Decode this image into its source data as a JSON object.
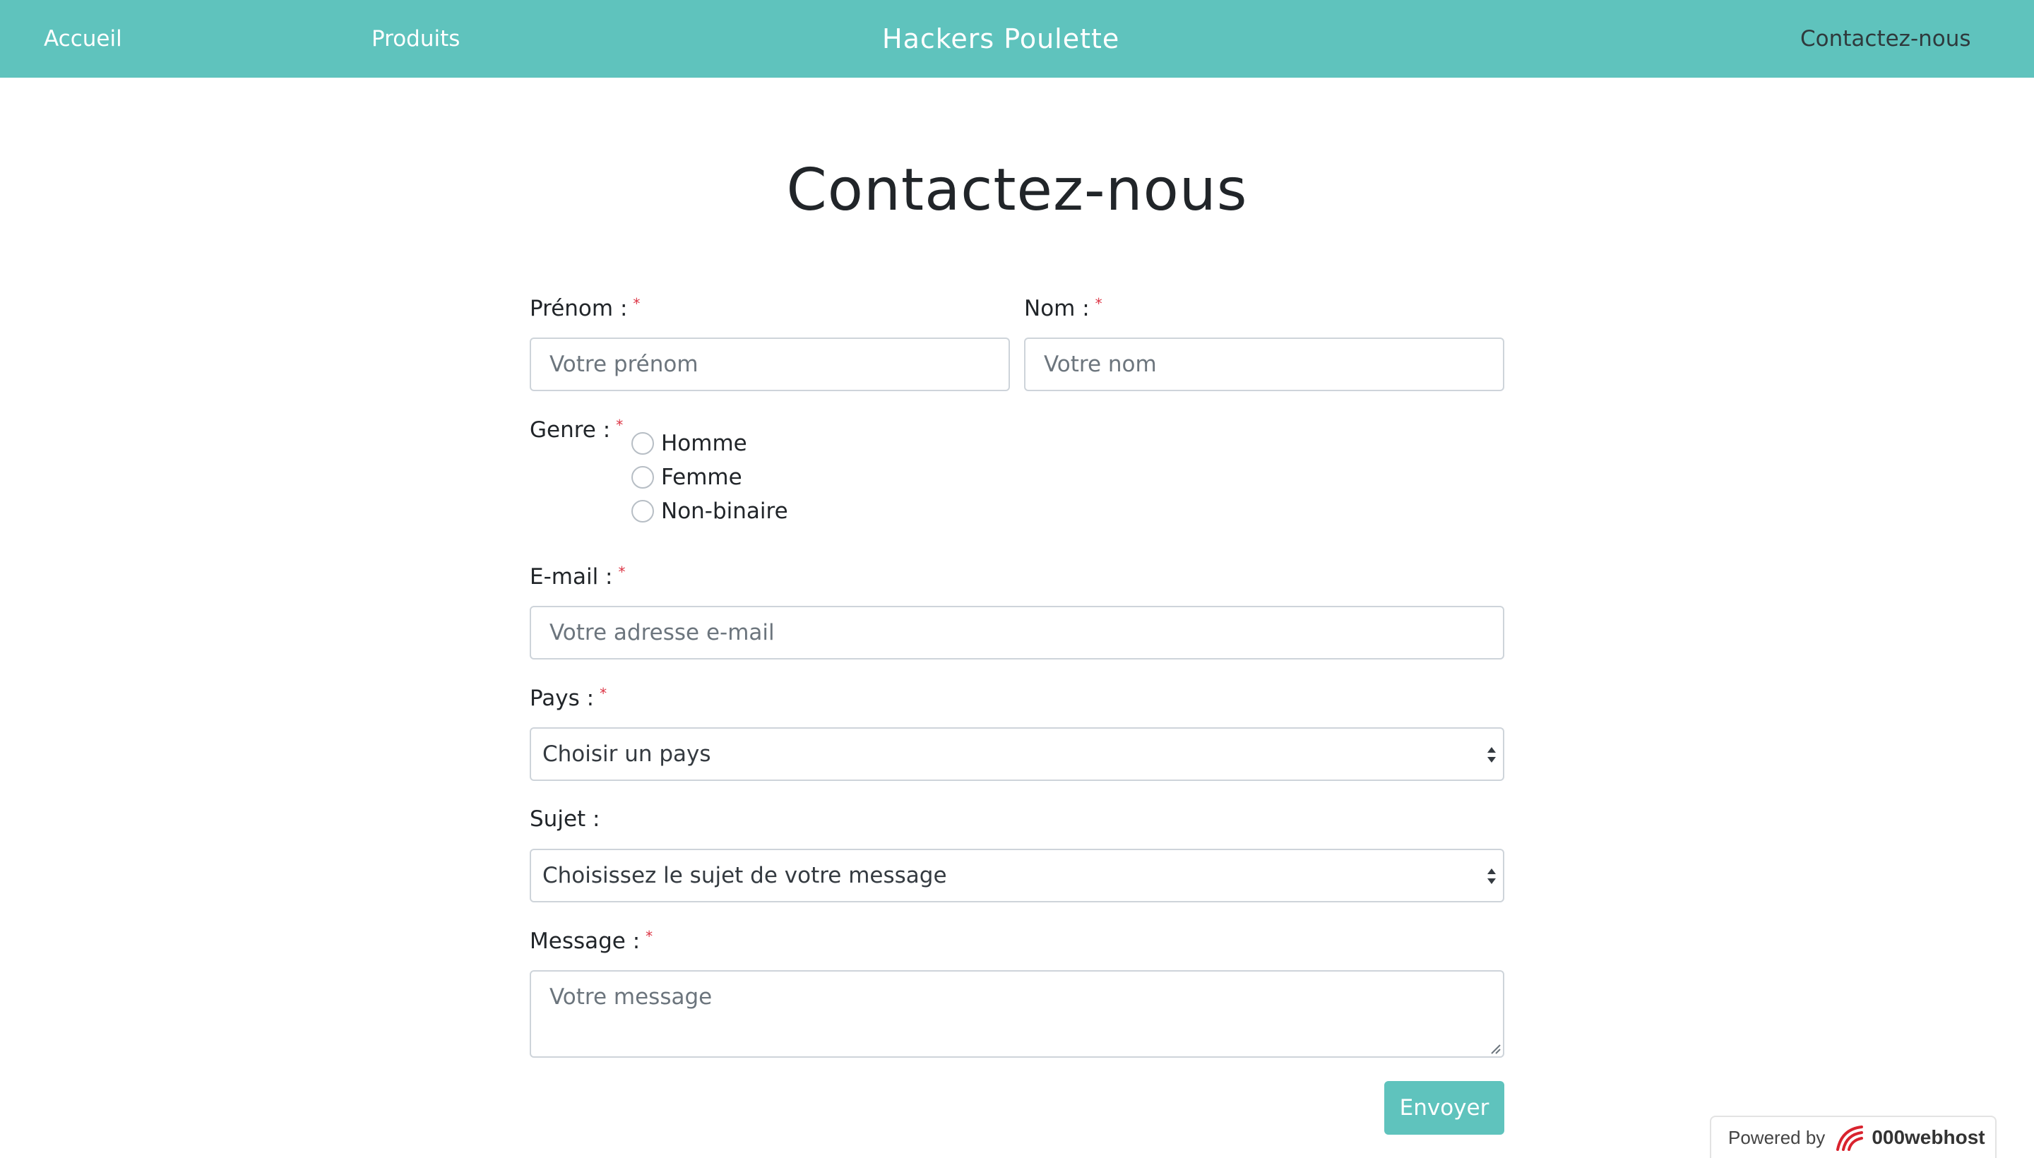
{
  "nav": {
    "home": "Accueil",
    "products": "Produits",
    "brand": "Hackers Poulette",
    "contact": "Contactez-nous"
  },
  "page": {
    "title": "Contactez-nous"
  },
  "form": {
    "required_mark": "*",
    "firstname": {
      "label": "Prénom :",
      "placeholder": "Votre prénom"
    },
    "lastname": {
      "label": "Nom :",
      "placeholder": "Votre nom"
    },
    "gender": {
      "label": "Genre :",
      "options": [
        "Homme",
        "Femme",
        "Non-binaire"
      ]
    },
    "email": {
      "label": "E-mail :",
      "placeholder": "Votre adresse e-mail"
    },
    "country": {
      "label": "Pays :",
      "selected": "Choisir un pays"
    },
    "subject": {
      "label": "Sujet :",
      "selected": "Choisissez le sujet de votre message"
    },
    "message": {
      "label": "Message :",
      "placeholder": "Votre message"
    },
    "submit": "Envoyer"
  },
  "badge": {
    "powered_by": "Powered by",
    "host": "000webhost"
  },
  "colors": {
    "accent": "#5fc3bd",
    "required": "#dc3545",
    "border": "#ced4da"
  }
}
